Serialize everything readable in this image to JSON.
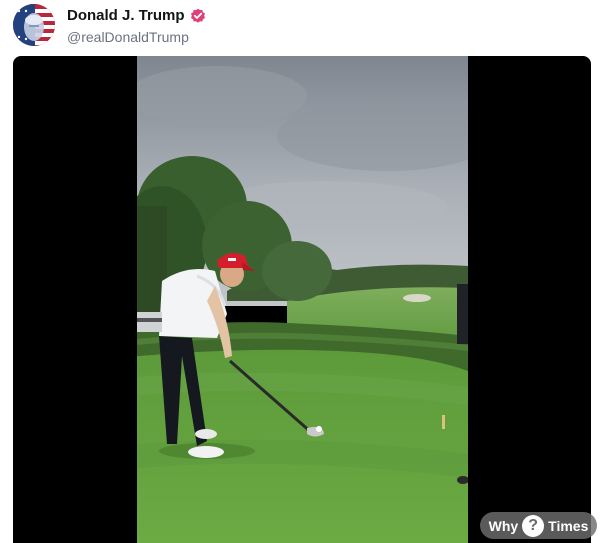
{
  "post": {
    "author": {
      "display_name": "Donald J. Trump",
      "handle": "@realDonaldTrump",
      "verified": true,
      "badge_color": "#e0407a"
    },
    "avatar_icon": "flag-portrait-avatar"
  },
  "media": {
    "type": "video",
    "scene": "golf-tee-shot",
    "background_color": "#000000"
  },
  "watermark": {
    "left_text": "Why",
    "icon_text": "?",
    "right_text": "Times"
  }
}
